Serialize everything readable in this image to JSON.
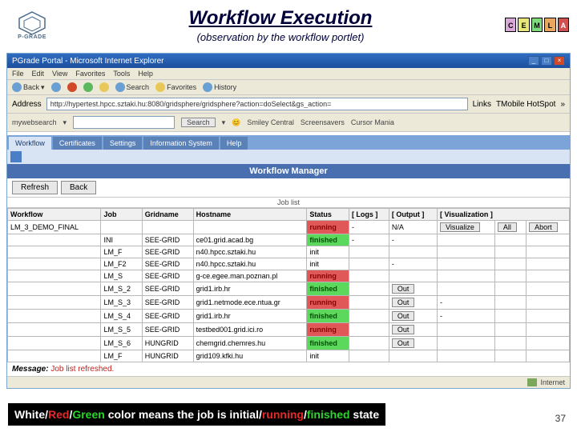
{
  "header": {
    "title": "Workflow Execution",
    "subtitle": "(observation by the workflow portlet)",
    "logo_label": "P-GRADE",
    "puzzle": [
      "C",
      "E",
      "M",
      "L",
      "A"
    ]
  },
  "ie": {
    "title": "PGrade Portal - Microsoft Internet Explorer",
    "menu": [
      "File",
      "Edit",
      "View",
      "Favorites",
      "Tools",
      "Help"
    ],
    "toolbar": {
      "back": "Back",
      "search": "Search",
      "favorites": "Favorites",
      "history": "History"
    },
    "address_label": "Address",
    "address": "http://hypertest.hpcc.sztaki.hu:8080/gridsphere/gridsphere?action=doSelect&gs_action=",
    "links_label": "Links",
    "links_val": "TMobile HotSpot",
    "searchbar": {
      "label": "mywebsearch",
      "btn": "Search",
      "opts": [
        "Smiley Central",
        "Screensavers",
        "Cursor Mania"
      ]
    },
    "status": "Internet"
  },
  "portal": {
    "tabs": [
      "Workflow",
      "Certificates",
      "Settings",
      "Information System",
      "Help"
    ],
    "sel": 0,
    "wm_title": "Workflow Manager",
    "refresh": "Refresh",
    "back": "Back",
    "sub_label": "Job list"
  },
  "cols": [
    "Workflow",
    "Job",
    "Gridname",
    "Hostname",
    "Status",
    "[ Logs ]",
    "[ Output ]",
    "[ Visualization ]"
  ],
  "rows": [
    {
      "wf": "LM_3_DEMO_FINAL",
      "job": "",
      "grid": "",
      "host": "",
      "status": "running",
      "cls": "st-running",
      "logs": "-",
      "out": "N/A",
      "viz": [
        "Visualize",
        "All",
        "Abort"
      ]
    },
    {
      "wf": "",
      "job": "INI",
      "grid": "SEE-GRID",
      "host": "ce01.grid.acad.bg",
      "status": "finished",
      "cls": "st-finished",
      "logs": "-",
      "out": "-",
      "viz": []
    },
    {
      "wf": "",
      "job": "LM_F",
      "grid": "SEE-GRID",
      "host": "n40.hpcc.sztaki.hu",
      "status": "init",
      "cls": "st-init",
      "logs": "",
      "out": "",
      "viz": []
    },
    {
      "wf": "",
      "job": "LM_F2",
      "grid": "SEE-GRID",
      "host": "n40.hpcc.sztaki.hu",
      "status": "init",
      "cls": "st-init",
      "logs": "",
      "out": "-",
      "viz": []
    },
    {
      "wf": "",
      "job": "LM_S",
      "grid": "SEE-GRID",
      "host": "g-ce.egee.man.poznan.pl",
      "status": "running",
      "cls": "st-running",
      "logs": "",
      "out": "",
      "viz": []
    },
    {
      "wf": "",
      "job": "LM_S_2",
      "grid": "SEE-GRID",
      "host": "grid1.irb.hr",
      "status": "finished",
      "cls": "st-finished",
      "logs": "",
      "out": "Out",
      "viz": []
    },
    {
      "wf": "",
      "job": "LM_S_3",
      "grid": "SEE-GRID",
      "host": "grid1.netmode.ece.ntua.gr",
      "status": "running",
      "cls": "st-running",
      "logs": "",
      "out": "Out",
      "viz": [
        "-"
      ]
    },
    {
      "wf": "",
      "job": "LM_S_4",
      "grid": "SEE-GRID",
      "host": "grid1.irb.hr",
      "status": "finished",
      "cls": "st-finished",
      "logs": "",
      "out": "Out",
      "viz": [
        "-"
      ]
    },
    {
      "wf": "",
      "job": "LM_S_5",
      "grid": "SEE-GRID",
      "host": "testbed001.grid.ici.ro",
      "status": "running",
      "cls": "st-running",
      "logs": "",
      "out": "Out",
      "viz": []
    },
    {
      "wf": "",
      "job": "LM_S_6",
      "grid": "HUNGRID",
      "host": "chemgrid.chemres.hu",
      "status": "finished",
      "cls": "st-finished",
      "logs": "",
      "out": "Out",
      "viz": []
    },
    {
      "wf": "",
      "job": "LM_F",
      "grid": "HUNGRID",
      "host": "grid109.kfki.hu",
      "status": "init",
      "cls": "st-init",
      "logs": "",
      "out": "",
      "viz": []
    }
  ],
  "msg": {
    "label": "Message:",
    "text": "Job list refreshed."
  },
  "legend": {
    "w": "White",
    "r": "Red",
    "g": "Green",
    "mid": " color means the job is ",
    "i": "initial",
    "run": "running",
    "fin": "finished",
    "end": " state"
  },
  "page": "37"
}
